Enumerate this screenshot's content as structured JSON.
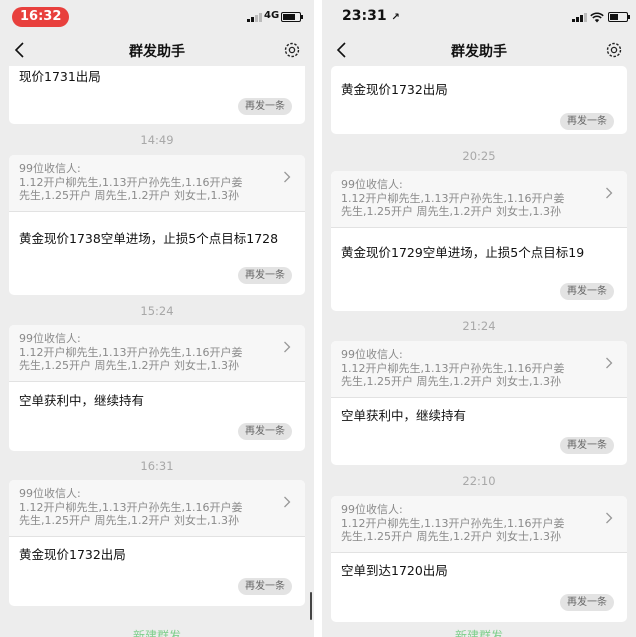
{
  "left": {
    "status": {
      "time": "16:32",
      "network": "4G"
    },
    "nav": {
      "title": "群发助手"
    },
    "top_card": {
      "message": "现价1731出局",
      "resend": "再发一条"
    },
    "entries": [
      {
        "time": "14:49",
        "recipients_label": "99位收信人:",
        "recipients_line1": "1.12开户柳先生,1.13开户孙先生,1.16开户姜",
        "recipients_line2": "先生,1.25开户 周先生,1.2开户 刘女士,1.3孙",
        "message": "黄金现价1738空单进场，止损5个点目标1728",
        "resend": "再发一条"
      },
      {
        "time": "15:24",
        "recipients_label": "99位收信人:",
        "recipients_line1": "1.12开户柳先生,1.13开户孙先生,1.16开户姜",
        "recipients_line2": "先生,1.25开户 周先生,1.2开户 刘女士,1.3孙",
        "message": "空单获利中，继续持有",
        "resend": "再发一条"
      },
      {
        "time": "16:31",
        "recipients_label": "99位收信人:",
        "recipients_line1": "1.12开户柳先生,1.13开户孙先生,1.16开户姜",
        "recipients_line2": "先生,1.25开户 周先生,1.2开户 刘女士,1.3孙",
        "message": "黄金现价1732出局",
        "resend": "再发一条"
      }
    ],
    "bottom_button": "新建群发"
  },
  "right": {
    "status": {
      "time": "23:31",
      "location_arrow": "↗"
    },
    "nav": {
      "title": "群发助手"
    },
    "top_card": {
      "message": "黄金现价1732出局",
      "resend": "再发一条"
    },
    "entries": [
      {
        "time": "20:25",
        "recipients_label": "99位收信人:",
        "recipients_line1": "1.12开户柳先生,1.13开户孙先生,1.16开户姜",
        "recipients_line2": "先生,1.25开户 周先生,1.2开户 刘女士,1.3孙",
        "message": "黄金现价1729空单进场，止损5个点目标19",
        "resend": "再发一条"
      },
      {
        "time": "21:24",
        "recipients_label": "99位收信人:",
        "recipients_line1": "1.12开户柳先生,1.13开户孙先生,1.16开户姜",
        "recipients_line2": "先生,1.25开户 周先生,1.2开户 刘女士,1.3孙",
        "message": "空单获利中，继续持有",
        "resend": "再发一条"
      },
      {
        "time": "22:10",
        "recipients_label": "99位收信人:",
        "recipients_line1": "1.12开户柳先生,1.13开户孙先生,1.16开户姜",
        "recipients_line2": "先生,1.25开户 周先生,1.2开户 刘女士,1.3孙",
        "message": "空单到达1720出局",
        "resend": "再发一条"
      }
    ],
    "bottom_button": "新建群发"
  },
  "colors": {
    "background": "#ededed",
    "accent": "#07c160",
    "status_pill": "#e8403d"
  },
  "icons": [
    "back-icon",
    "gear-icon",
    "chevron-right-icon",
    "signal-icon",
    "wifi-icon",
    "battery-icon"
  ]
}
